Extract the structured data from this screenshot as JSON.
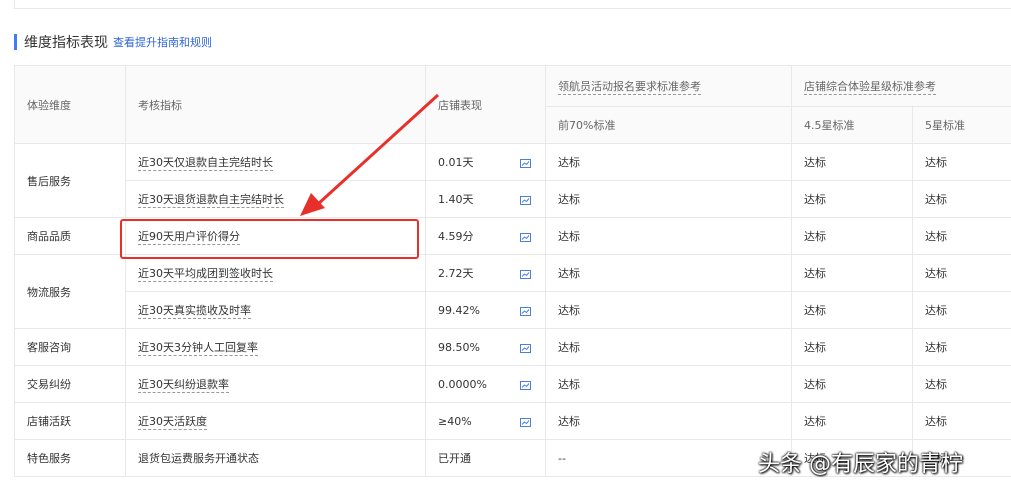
{
  "section": {
    "title": "维度指标表现",
    "link": "查看提升指南和规则"
  },
  "table": {
    "headers": {
      "dimension": "体验维度",
      "indicator": "考核指标",
      "performance": "店铺表现",
      "navigator_group": "领航员活动报名要求标准参考",
      "navigator_top70": "前70%标准",
      "star_group": "店铺综合体验星级标准参考",
      "star_45": "4.5星标准",
      "star_5": "5星标准"
    },
    "dimensions": [
      "售后服务",
      "商品品质",
      "物流服务",
      "客服咨询",
      "交易纠纷",
      "店铺活跃",
      "特色服务"
    ],
    "rows": [
      {
        "indicator": "近30天仅退款自主完结时长",
        "value": "0.01天",
        "top70": "达标",
        "star45": "达标",
        "star5": "达标"
      },
      {
        "indicator": "近30天退货退款自主完结时长",
        "value": "1.40天",
        "top70": "达标",
        "star45": "达标",
        "star5": "达标"
      },
      {
        "indicator": "近90天用户评价得分",
        "value": "4.59分",
        "top70": "达标",
        "star45": "达标",
        "star5": "达标"
      },
      {
        "indicator": "近30天平均成团到签收时长",
        "value": "2.72天",
        "top70": "达标",
        "star45": "达标",
        "star5": "达标"
      },
      {
        "indicator": "近30天真实揽收及时率",
        "value": "99.42%",
        "top70": "达标",
        "star45": "达标",
        "star5": "达标"
      },
      {
        "indicator": "近30天3分钟人工回复率",
        "value": "98.50%",
        "top70": "达标",
        "star45": "达标",
        "star5": "达标"
      },
      {
        "indicator": "近30天纠纷退款率",
        "value": "0.0000%",
        "top70": "达标",
        "star45": "达标",
        "star5": "达标"
      },
      {
        "indicator": "近30天活跃度",
        "value": "≥40%",
        "top70": "达标",
        "star45": "达标",
        "star5": "达标"
      },
      {
        "indicator": "退货包运费服务开通状态",
        "value": "已开通",
        "top70": "--",
        "star45": "达标",
        "star5": "达标"
      }
    ]
  },
  "icons": {
    "trend": "trend-chart-icon"
  },
  "colors": {
    "accent": "#3d7bff",
    "link": "#2f64d9",
    "highlight": "#e8302b"
  },
  "watermark": "头条 @有辰家的青柠"
}
